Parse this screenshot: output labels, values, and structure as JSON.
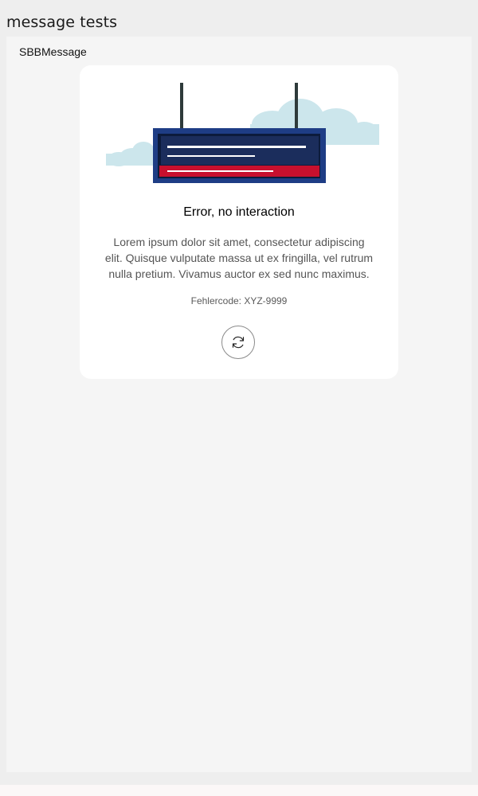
{
  "page": {
    "title": "message tests"
  },
  "section": {
    "title": "SBBMessage"
  },
  "message": {
    "title": "Error, no interaction",
    "body": "Lorem ipsum dolor sit amet, consectetur adipiscing elit. Quisque vulputate massa ut ex fringilla, vel rutrum nulla pretium. Vivamus auctor ex sed nunc maximus.",
    "error_code": "Fehlercode: XYZ-9999",
    "illustration": "departure-board-illustration",
    "retry_icon": "refresh-icon"
  },
  "colors": {
    "board_blue": "#1e3d85",
    "board_red": "#c8102e",
    "cloud": "#cce6ec",
    "pole": "#2e3a3a"
  }
}
